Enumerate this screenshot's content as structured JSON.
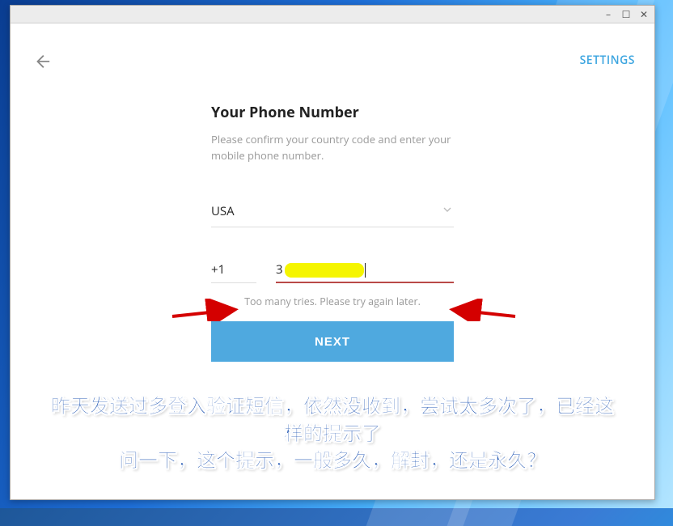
{
  "window": {
    "minimize": "–",
    "maximize": "☐",
    "close": "✕"
  },
  "header": {
    "settings": "SETTINGS"
  },
  "form": {
    "heading": "Your Phone Number",
    "subtext": "Please confirm your country code and enter your mobile phone number.",
    "country": "USA",
    "code": "+1",
    "phone_leading": "3",
    "error": "Too many tries. Please try again later.",
    "next": "NEXT"
  },
  "annotation": {
    "line1": "昨天发送过多登入验证短信，依然没收到，尝试太多次了，已经这样的提示了",
    "line2": "问一下，这个提示，一般多久，解封，还是永久？"
  }
}
